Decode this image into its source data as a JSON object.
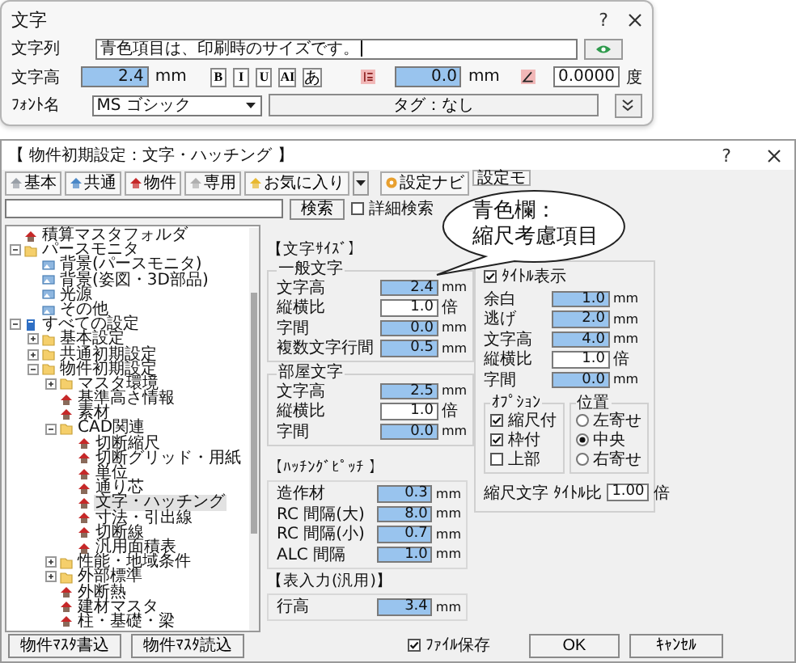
{
  "text_dialog": {
    "title": "文字",
    "help": "?",
    "string_label": "文字列",
    "string_value": "青色項目は、印刷時のサイズです。",
    "height_label": "文字高",
    "height": {
      "value": "2.4",
      "unit": "mm",
      "scaled": true
    },
    "style_buttons": [
      "B",
      "I",
      "U",
      "AI",
      "あ"
    ],
    "spacing": {
      "value": "0.0",
      "unit": "mm",
      "scaled": true
    },
    "angle": {
      "value": "0.0000",
      "unit": "度",
      "scaled": false
    },
    "font_label": "ﾌｫﾝﾄ名",
    "font": "MS ゴシック",
    "tag_button": "タグ：なし"
  },
  "settings_dialog": {
    "title": "【 物件初期設定：文字・ハッチング 】",
    "help": "?",
    "toolbar": [
      {
        "label": "基本"
      },
      {
        "label": "共通"
      },
      {
        "label": "物件"
      },
      {
        "label": "専用"
      },
      {
        "label": "お気に入り"
      }
    ],
    "navi_button": "設定ナビ",
    "mode_button": "設定モ",
    "search": {
      "button": "検索",
      "detail": {
        "label": "詳細検索",
        "checked": false
      }
    },
    "tree": [
      {
        "label": "積算マスタフォルダ",
        "kind": "item",
        "selected": false
      },
      {
        "label": "パースモニタ",
        "kind": "folder",
        "expanded": true,
        "selected": false,
        "children": [
          {
            "label": "背景(パースモニタ)",
            "kind": "image",
            "selected": false
          },
          {
            "label": "背景(姿図・3D部品)",
            "kind": "image",
            "selected": false
          },
          {
            "label": "光源",
            "kind": "image",
            "selected": false
          },
          {
            "label": "その他",
            "kind": "image",
            "selected": false
          }
        ]
      },
      {
        "label": "すべての設定",
        "kind": "book",
        "expanded": true,
        "selected": false,
        "children": [
          {
            "label": "基本設定",
            "kind": "folder",
            "expanded": false,
            "selected": false
          },
          {
            "label": "共通初期設定",
            "kind": "folder",
            "expanded": false,
            "selected": false
          },
          {
            "label": "物件初期設定",
            "kind": "folder",
            "expanded": true,
            "selected": false,
            "children": [
              {
                "label": "マスタ環境",
                "kind": "folder",
                "expanded": false,
                "selected": false
              },
              {
                "label": "基準高さ情報",
                "kind": "item",
                "selected": false
              },
              {
                "label": "素材",
                "kind": "item",
                "selected": false
              },
              {
                "label": "CAD関連",
                "kind": "folder",
                "expanded": true,
                "selected": false,
                "children": [
                  {
                    "label": "切断縮尺",
                    "kind": "item",
                    "selected": false
                  },
                  {
                    "label": "切断グリッド・用紙",
                    "kind": "item",
                    "selected": false
                  },
                  {
                    "label": "単位",
                    "kind": "item",
                    "selected": false
                  },
                  {
                    "label": "通り芯",
                    "kind": "item",
                    "selected": false
                  },
                  {
                    "label": "文字・ハッチング",
                    "kind": "item",
                    "selected": true
                  },
                  {
                    "label": "寸法・引出線",
                    "kind": "item",
                    "selected": false
                  },
                  {
                    "label": "切断線",
                    "kind": "item",
                    "selected": false
                  },
                  {
                    "label": "汎用面積表",
                    "kind": "item",
                    "selected": false
                  }
                ]
              },
              {
                "label": "性能・地域条件",
                "kind": "folder",
                "expanded": false,
                "selected": false
              },
              {
                "label": "外部標準",
                "kind": "folder",
                "expanded": false,
                "selected": false
              },
              {
                "label": "外断熱",
                "kind": "item",
                "selected": false
              },
              {
                "label": "建材マスタ",
                "kind": "item",
                "selected": false
              },
              {
                "label": "柱・基礎・梁",
                "kind": "item",
                "selected": false
              }
            ]
          }
        ]
      }
    ],
    "text_size": {
      "heading": "【文字ｻｲｽﾞ】",
      "groups": [
        {
          "title": "一般文字",
          "fields": [
            {
              "label": "文字高",
              "value": "2.4",
              "unit": "mm",
              "scaled": true
            },
            {
              "label": "縦横比",
              "value": "1.0",
              "unit": "倍",
              "scaled": false
            },
            {
              "label": "字間",
              "value": "0.0",
              "unit": "mm",
              "scaled": true
            },
            {
              "label": "複数文字行間",
              "value": "0.5",
              "unit": "mm",
              "scaled": true
            }
          ]
        },
        {
          "title": "部屋文字",
          "fields": [
            {
              "label": "文字高",
              "value": "2.5",
              "unit": "mm",
              "scaled": true
            },
            {
              "label": "縦横比",
              "value": "1.0",
              "unit": "倍",
              "scaled": false
            },
            {
              "label": "字間",
              "value": "0.0",
              "unit": "mm",
              "scaled": true
            }
          ]
        }
      ]
    },
    "hatching": {
      "heading": "【ﾊｯﾁﾝｸﾞﾋﾟｯﾁ 】",
      "fields": [
        {
          "label": "造作材",
          "value": "0.3",
          "unit": "mm",
          "scaled": true
        },
        {
          "label": "RC 間隔(大)",
          "value": "8.0",
          "unit": "mm",
          "scaled": true
        },
        {
          "label": "RC 間隔(小)",
          "value": "0.7",
          "unit": "mm",
          "scaled": true
        },
        {
          "label": "ALC 間隔",
          "value": "1.0",
          "unit": "mm",
          "scaled": true
        }
      ]
    },
    "table_input": {
      "heading": "【表入力(汎用)】",
      "fields": [
        {
          "label": "行高",
          "value": "3.4",
          "unit": "mm",
          "scaled": true
        }
      ]
    },
    "title_display": {
      "label": "ﾀｲﾄﾙ表示",
      "checked": true,
      "fields": [
        {
          "label": "余白",
          "value": "1.0",
          "unit": "mm",
          "scaled": true
        },
        {
          "label": "逃げ",
          "value": "2.0",
          "unit": "mm",
          "scaled": true
        },
        {
          "label": "文字高",
          "value": "4.0",
          "unit": "mm",
          "scaled": true
        },
        {
          "label": "縦横比",
          "value": "1.0",
          "unit": "倍",
          "scaled": false
        },
        {
          "label": "字間",
          "value": "0.0",
          "unit": "mm",
          "scaled": true
        }
      ],
      "options": {
        "title": "ｵﾌﾟｼｮﾝ",
        "items": [
          {
            "label": "縮尺付",
            "checked": true
          },
          {
            "label": "枠付",
            "checked": true
          },
          {
            "label": "上部",
            "checked": false
          }
        ]
      },
      "position": {
        "title": "位置",
        "items": [
          {
            "label": "左寄せ",
            "selected": false
          },
          {
            "label": "中央",
            "selected": true
          },
          {
            "label": "右寄せ",
            "selected": false
          }
        ]
      },
      "ratio": {
        "label": "縮尺文字 ﾀｲﾄﾙ比",
        "value": "1.00",
        "unit": "倍",
        "scaled": false
      }
    },
    "bottom": {
      "write_button": "物件ﾏｽﾀ書込",
      "read_button": "物件ﾏｽﾀ読込",
      "file_save": {
        "label": "ﾌｧｲﾙ保存",
        "checked": true
      },
      "ok": "OK",
      "cancel": "ｷｬﾝｾﾙ"
    }
  },
  "callout": {
    "lines": [
      "青色欄：",
      "縮尺考慮項目"
    ]
  }
}
